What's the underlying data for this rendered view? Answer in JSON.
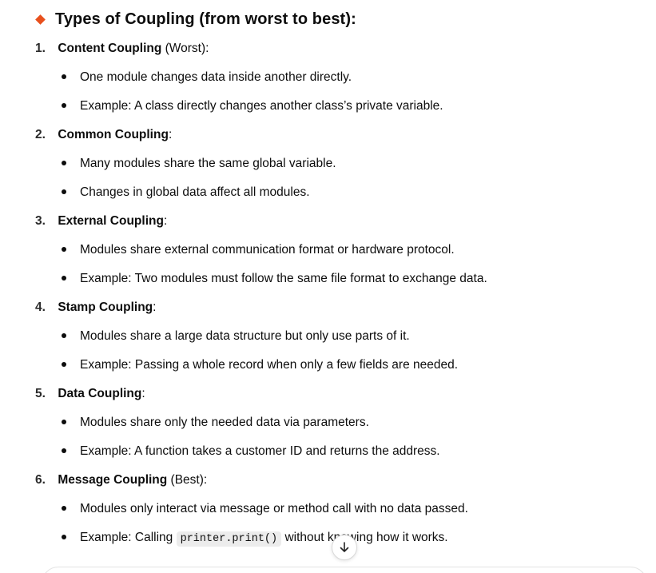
{
  "heading": "Types of Coupling (from worst to best):",
  "items": [
    {
      "number": "1.",
      "name": "Content Coupling",
      "suffix": " (Worst):",
      "bullets": [
        "One module changes data inside another directly.",
        "Example: A class directly changes another class’s private variable."
      ]
    },
    {
      "number": "2.",
      "name": "Common Coupling",
      "suffix": ":",
      "bullets": [
        "Many modules share the same global variable.",
        "Changes in global data affect all modules."
      ]
    },
    {
      "number": "3.",
      "name": "External Coupling",
      "suffix": ":",
      "bullets": [
        "Modules share external communication format or hardware protocol.",
        "Example: Two modules must follow the same file format to exchange data."
      ]
    },
    {
      "number": "4.",
      "name": "Stamp Coupling",
      "suffix": ":",
      "bullets": [
        "Modules share a large data structure but only use parts of it.",
        "Example: Passing a whole record when only a few fields are needed."
      ]
    },
    {
      "number": "5.",
      "name": "Data Coupling",
      "suffix": ":",
      "bullets": [
        "Modules share only the needed data via parameters.",
        "Example: A function takes a customer ID and returns the address."
      ]
    },
    {
      "number": "6.",
      "name": "Message Coupling",
      "suffix": " (Best):",
      "bullets": [
        "Modules only interact via message or method call with no data passed."
      ],
      "last_bullet": {
        "before": "Example: Calling ",
        "code": "printer.print()",
        "after": " without knowing how it works."
      }
    }
  ],
  "scroll_button_icon": "arrow-down-icon",
  "accent_color": "#e8501d"
}
